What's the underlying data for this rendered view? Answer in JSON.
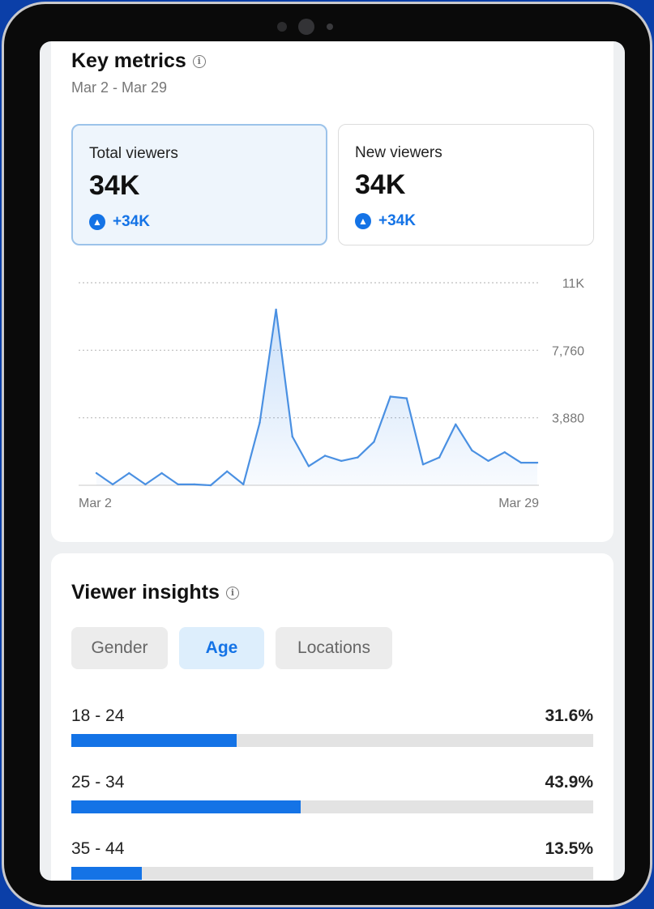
{
  "key_metrics": {
    "title": "Key metrics",
    "info_icon": "info-icon",
    "date_range": "Mar 2 - Mar 29",
    "cards": [
      {
        "label": "Total viewers",
        "value": "34K",
        "delta": "+34K",
        "selected": true
      },
      {
        "label": "New viewers",
        "value": "34K",
        "delta": "+34K",
        "selected": false
      }
    ]
  },
  "chart_data": {
    "type": "area",
    "x_start_label": "Mar 2",
    "x_end_label": "Mar 29",
    "y_ticks": [
      {
        "value": 11640,
        "label": "11K"
      },
      {
        "value": 7760,
        "label": "7,760"
      },
      {
        "value": 3880,
        "label": "3,880"
      }
    ],
    "ylim": [
      0,
      11640
    ],
    "x_days": [
      2,
      3,
      4,
      5,
      6,
      7,
      8,
      9,
      10,
      11,
      12,
      13,
      14,
      15,
      16,
      17,
      18,
      19,
      20,
      21,
      22,
      23,
      24,
      25,
      26,
      27,
      28,
      29
    ],
    "values": [
      700,
      50,
      700,
      50,
      700,
      50,
      50,
      0,
      800,
      50,
      3600,
      10100,
      2800,
      1100,
      1700,
      1400,
      1600,
      2500,
      5100,
      5000,
      1200,
      1600,
      3500,
      2000,
      1400,
      1900,
      1300,
      1300
    ],
    "grid": true,
    "accent_color": "#1473e6"
  },
  "viewer_insights": {
    "title": "Viewer insights",
    "info_icon": "info-icon",
    "tabs": [
      {
        "label": "Gender",
        "active": false
      },
      {
        "label": "Age",
        "active": true
      },
      {
        "label": "Locations",
        "active": false
      }
    ],
    "age_groups": [
      {
        "label": "18 - 24",
        "percent": "31.6%",
        "fraction": 0.316
      },
      {
        "label": "25 - 34",
        "percent": "43.9%",
        "fraction": 0.439
      },
      {
        "label": "35 - 44",
        "percent": "13.5%",
        "fraction": 0.135
      }
    ]
  },
  "colors": {
    "accent": "#1473e6",
    "selected_card_bg": "#eef5fc",
    "device_bg": "#0b3fa8"
  }
}
